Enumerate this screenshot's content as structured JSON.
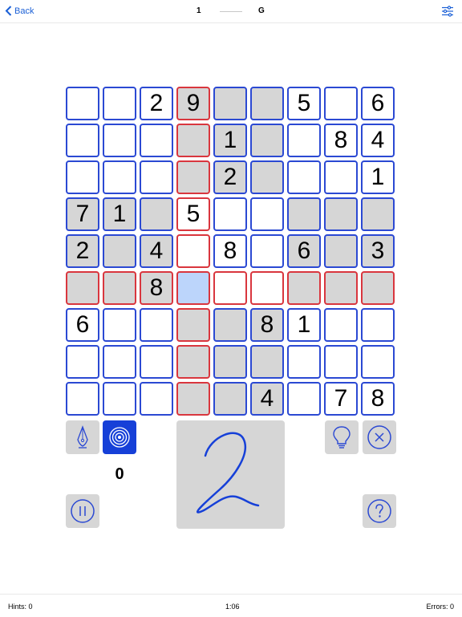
{
  "header": {
    "back_label": "Back",
    "puzzle_number": "1",
    "difficulty": "G",
    "settings_icon": "sliders-icon"
  },
  "board": {
    "rows": [
      [
        "",
        "",
        "2",
        "9",
        "",
        "",
        "5",
        "",
        "6"
      ],
      [
        "",
        "",
        "",
        "",
        "1",
        "",
        "",
        "8",
        "4"
      ],
      [
        "",
        "",
        "",
        "",
        "2",
        "",
        "",
        "",
        "1"
      ],
      [
        "7",
        "1",
        "",
        "5",
        "",
        "",
        "",
        "",
        ""
      ],
      [
        "2",
        "",
        "4",
        "",
        "8",
        "",
        "6",
        "",
        "3"
      ],
      [
        "",
        "",
        "8",
        "",
        "",
        "",
        "",
        "",
        ""
      ],
      [
        "6",
        "",
        "",
        "",
        "",
        "8",
        "1",
        "",
        ""
      ],
      [
        "",
        "",
        "",
        "",
        "",
        "",
        "",
        "",
        ""
      ],
      [
        "",
        "",
        "",
        "",
        "",
        "4",
        "",
        "7",
        "8"
      ]
    ],
    "highlighted": [
      [
        0,
        3
      ],
      [
        0,
        4
      ],
      [
        0,
        5
      ],
      [
        1,
        3
      ],
      [
        1,
        4
      ],
      [
        1,
        5
      ],
      [
        2,
        3
      ],
      [
        2,
        4
      ],
      [
        2,
        5
      ],
      [
        3,
        0
      ],
      [
        3,
        1
      ],
      [
        3,
        2
      ],
      [
        3,
        6
      ],
      [
        3,
        7
      ],
      [
        3,
        8
      ],
      [
        4,
        0
      ],
      [
        4,
        1
      ],
      [
        4,
        2
      ],
      [
        4,
        6
      ],
      [
        4,
        7
      ],
      [
        4,
        8
      ],
      [
        5,
        0
      ],
      [
        5,
        1
      ],
      [
        5,
        2
      ],
      [
        5,
        6
      ],
      [
        5,
        7
      ],
      [
        5,
        8
      ],
      [
        6,
        3
      ],
      [
        6,
        4
      ],
      [
        6,
        5
      ],
      [
        7,
        3
      ],
      [
        7,
        4
      ],
      [
        7,
        5
      ],
      [
        8,
        3
      ],
      [
        8,
        4
      ],
      [
        8,
        5
      ]
    ],
    "selected": [
      5,
      3
    ],
    "selected_row": 5,
    "selected_col": 3
  },
  "controls": {
    "pen_icon": "pen-nib-icon",
    "target_icon": "target-icon",
    "counter": "0",
    "pause_icon": "pause-icon",
    "hint_icon": "lightbulb-icon",
    "clear_icon": "close-circle-icon",
    "help_icon": "help-icon",
    "handwriting_digit": "2",
    "accent_color": "#1640d8",
    "error_color": "#d9363e"
  },
  "status": {
    "hints": "Hints: 0",
    "time": "1:06",
    "errors": "Errors: 0"
  }
}
